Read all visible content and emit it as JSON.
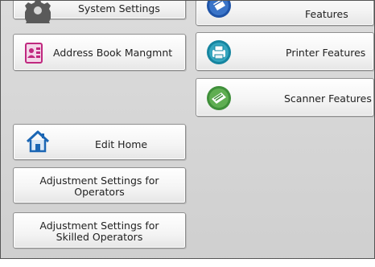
{
  "left_column": {
    "system_settings_label": "System Settings",
    "address_book_label": "Address Book Mangmnt",
    "edit_home_label": "Edit Home",
    "adjust_operators_label": "Adjustment Settings for\nOperators",
    "adjust_skilled_label": "Adjustment Settings for\nSkilled Operators"
  },
  "right_column": {
    "features_label": "Features",
    "printer_features_label": "Printer Features",
    "scanner_features_label": "Scanner Features"
  },
  "icons": {
    "system_settings": "gear-icon",
    "address_book": "address-book-icon",
    "edit_home": "home-icon",
    "features": "features-icon",
    "printer": "printer-icon",
    "scanner": "scanner-icon"
  },
  "colors": {
    "address_book": "#c0287f",
    "home": "#1b66b4",
    "features": "#1f54a8",
    "printer": "#1685a0",
    "scanner": "#3f8f3a"
  }
}
